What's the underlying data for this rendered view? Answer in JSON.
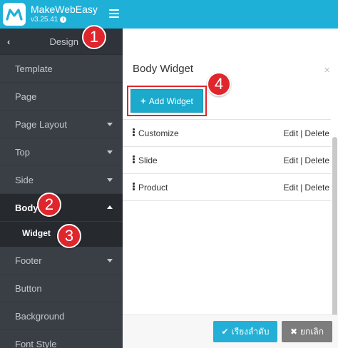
{
  "header": {
    "brand_name": "MakeWebEasy",
    "version": "v3.25.41",
    "logo_icon": "makeweb-logo-icon",
    "menu_icon": "hamburger-icon"
  },
  "sidebar": {
    "back_title": "Design",
    "items": [
      {
        "label": "Template"
      },
      {
        "label": "Page"
      },
      {
        "label": "Page Layout"
      },
      {
        "label": "Top"
      },
      {
        "label": "Side"
      },
      {
        "label": "Body"
      },
      {
        "label": "Widget"
      },
      {
        "label": "Footer"
      },
      {
        "label": "Button"
      },
      {
        "label": "Background"
      },
      {
        "label": "Font Style"
      }
    ]
  },
  "panel": {
    "title": "Body Widget",
    "close": "×",
    "add_button": "Add Widget",
    "rows": [
      {
        "name": "Customize",
        "edit": "Edit",
        "sep": "|",
        "delete": "Delete"
      },
      {
        "name": "Slide",
        "edit": "Edit",
        "sep": "|",
        "delete": "Delete"
      },
      {
        "name": "Product",
        "edit": "Edit",
        "sep": "|",
        "delete": "Delete"
      }
    ],
    "sort_button": "เรียงลำดับ",
    "cancel_button": "ยกเลิก"
  },
  "badges": [
    "1",
    "2",
    "3",
    "4"
  ],
  "colors": {
    "header": "#1fb0d8",
    "sidebar": "#3a3f46",
    "sidebar_active": "#26292e",
    "accent": "#1ba9cc",
    "badge": "#e0262d",
    "cancel": "#7d7d7d"
  }
}
